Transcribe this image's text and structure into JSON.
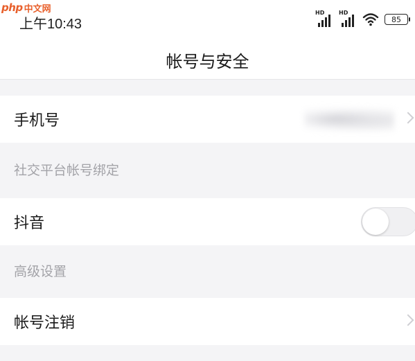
{
  "watermark": {
    "logo": "php",
    "text": "中文网"
  },
  "status_bar": {
    "time": "上午10:43",
    "signal_1_label": "HD",
    "signal_2_label": "HD",
    "wifi_icon": "wifi-icon",
    "battery": "85"
  },
  "header": {
    "title": "帐号与安全"
  },
  "rows": {
    "phone": {
      "label": "手机号",
      "value_blurred": true
    },
    "douyin": {
      "label": "抖音",
      "toggle_on": false
    },
    "cancel": {
      "label": "帐号注销"
    }
  },
  "sections": {
    "social": "社交平台帐号绑定",
    "advanced": "高级设置"
  },
  "colors": {
    "background": "#f4f4f6",
    "row_background": "#ffffff",
    "section_text": "#a3a3a8",
    "watermark": "#e8602c"
  }
}
